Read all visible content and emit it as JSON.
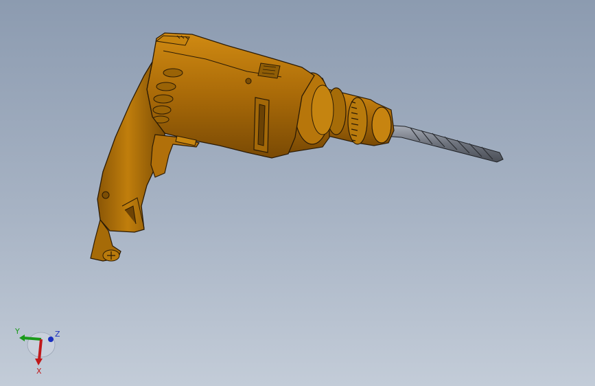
{
  "viewport": {
    "background_top": "#8c9bb0",
    "background_bottom": "#c3ccd8"
  },
  "model": {
    "part_color": "#b8770a",
    "edge_color": "#2a1a05",
    "bit_color": "#7d828c"
  },
  "triad": {
    "x_label": "X",
    "y_label": "Y",
    "z_label": "Z",
    "x_color": "#c0181a",
    "y_color": "#1a9a1a",
    "z_color": "#1a2fbf"
  }
}
